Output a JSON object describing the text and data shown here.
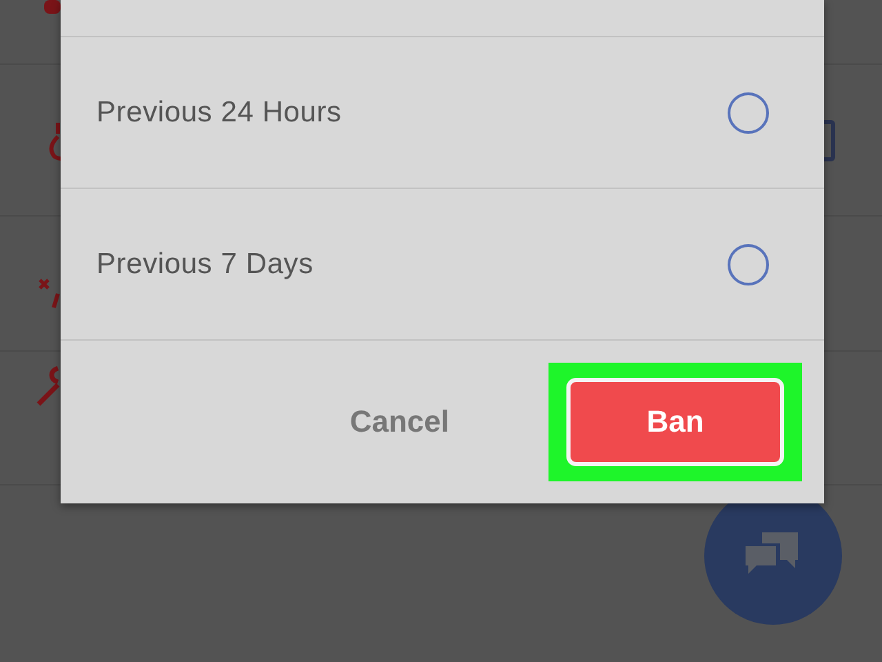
{
  "dialog": {
    "options": [
      {
        "label": "Previous 24 Hours",
        "selected": false
      },
      {
        "label": "Previous 7 Days",
        "selected": false
      }
    ],
    "buttons": [
      {
        "label": "Cancel",
        "kind": "text",
        "highlighted": false
      },
      {
        "label": "Ban",
        "kind": "danger",
        "highlighted": true
      }
    ]
  }
}
